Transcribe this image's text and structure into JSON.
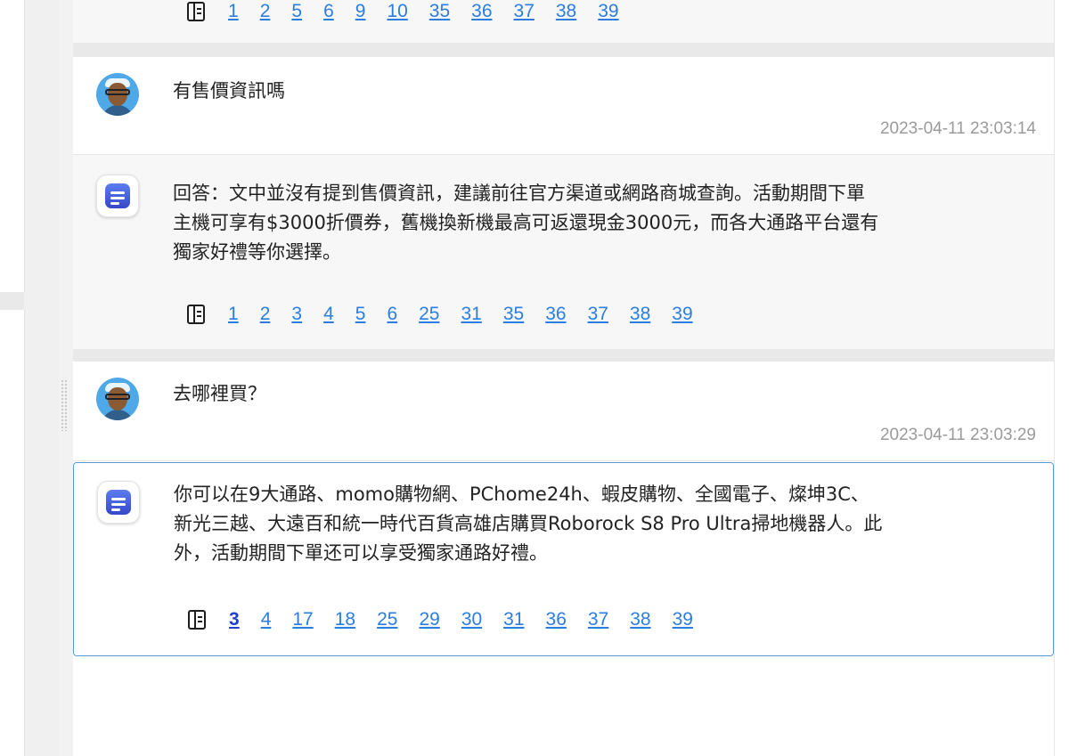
{
  "messages": [
    {
      "role": "answer",
      "text": "",
      "refs": [
        "1",
        "2",
        "5",
        "6",
        "9",
        "10",
        "35",
        "36",
        "37",
        "38",
        "39"
      ]
    },
    {
      "role": "question",
      "text": "有售價資訊嗎",
      "time": "2023-04-11 23:03:14"
    },
    {
      "role": "answer",
      "text_lines": [
        "回答：文中並沒有提到售價資訊，建議前往官方渠道或網路商城查詢。活動期間下單",
        "主機可享有$3000折價券，舊機換新機最高可返還現金3000元，而各大通路平台還有",
        "獨家好禮等你選擇。"
      ],
      "refs": [
        "1",
        "2",
        "3",
        "4",
        "5",
        "6",
        "25",
        "31",
        "35",
        "36",
        "37",
        "38",
        "39"
      ]
    },
    {
      "role": "question",
      "text": "去哪裡買？",
      "time": "2023-04-11 23:03:29"
    },
    {
      "role": "answer",
      "text_lines": [
        "你可以在9大通路、momo購物網、PChome24h、蝦皮購物、全國電子、燦坤3C、",
        "新光三越、大遠百和統一時代百貨高雄店購買Roborock S8 Pro Ultra掃地機器人。此",
        "外，活動期間下單还可以享受獨家通路好禮。"
      ],
      "refs": [
        "3",
        "4",
        "17",
        "18",
        "25",
        "29",
        "30",
        "31",
        "36",
        "37",
        "38",
        "39"
      ],
      "selected_ref": "3"
    }
  ],
  "icons": {
    "user_avatar": "user-avatar-icon",
    "bot_avatar": "bot-chat-icon",
    "sources": "book-icon"
  },
  "colors": {
    "link": "#2b7de0",
    "active_border": "#5b9bd5",
    "timestamp": "#9a9a9a"
  }
}
